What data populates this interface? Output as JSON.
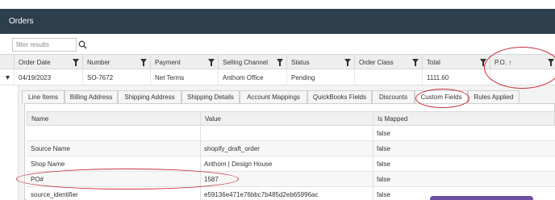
{
  "window": {
    "title": "Orders"
  },
  "filter": {
    "placeholder": "filter results"
  },
  "grid": {
    "columns": [
      {
        "label": "Order Date"
      },
      {
        "label": "Number"
      },
      {
        "label": "Payment"
      },
      {
        "label": "Selling Channel"
      },
      {
        "label": "Status"
      },
      {
        "label": "Order Class"
      },
      {
        "label": "Total"
      },
      {
        "label": "P.O. ↑"
      }
    ],
    "rows": [
      {
        "order_date": "04/19/2023",
        "number": "SO-7672",
        "payment": "Net Terms",
        "selling_channel": "Anthom Office",
        "status": "Pending",
        "order_class": "",
        "total": "1111.60",
        "po": ""
      }
    ]
  },
  "detail_tabs": [
    {
      "label": "Line Items"
    },
    {
      "label": "Billing Address"
    },
    {
      "label": "Shipping Address"
    },
    {
      "label": "Shipping Details"
    },
    {
      "label": "Account Mappings"
    },
    {
      "label": "QuickBooks Fields"
    },
    {
      "label": "Discounts"
    },
    {
      "label": "Custom Fields",
      "active": true
    },
    {
      "label": "Rules Applied"
    }
  ],
  "custom_fields": {
    "headers": {
      "name": "Name",
      "value": "Value",
      "is_mapped": "Is Mapped"
    },
    "rows": [
      {
        "name": "",
        "value": "",
        "is_mapped": "false"
      },
      {
        "name": "Source Name",
        "value": "shopify_draft_order",
        "is_mapped": "false"
      },
      {
        "name": "Shop Name",
        "value": "Anthom | Design House",
        "is_mapped": "false"
      },
      {
        "name": "PO#",
        "value": "1587",
        "is_mapped": "false"
      },
      {
        "name": "source_identifier",
        "value": "e59136e471e76bbc7b485d2eb65996ac",
        "is_mapped": "false"
      }
    ]
  },
  "colors": {
    "titlebar": "#2d3e4d",
    "annotation": "#c8303a",
    "accent_button": "#6c4fa3"
  },
  "icons": {
    "search": "search-icon",
    "filter": "filter-icon",
    "expand": "expand-triangle-icon"
  }
}
